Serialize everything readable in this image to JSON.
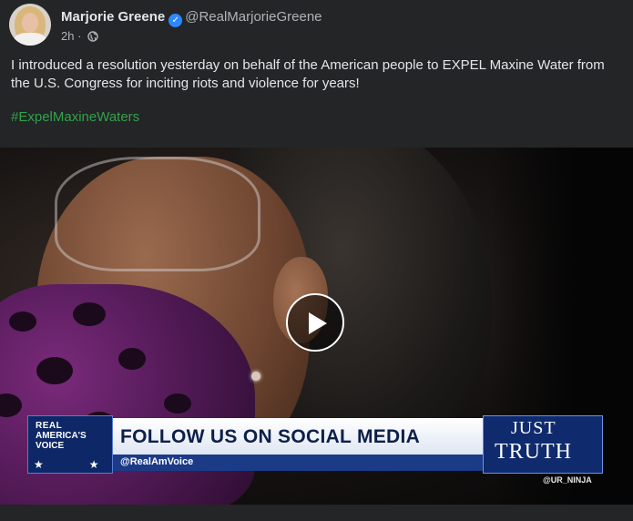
{
  "post": {
    "author_name": "Marjorie Greene",
    "author_handle": "@RealMarjorieGreene",
    "time": "2h",
    "separator": "·",
    "body": "I introduced a resolution yesterday on behalf of the American people to EXPEL Maxine Water from the U.S. Congress for inciting riots and violence for years!",
    "hashtag": "#ExpelMaxineWaters",
    "icons": {
      "verified": "verified-badge-icon",
      "audience": "globe-icon",
      "play": "play-icon"
    }
  },
  "video": {
    "network_logo": {
      "line1": "REAL",
      "line2": "AMERICA'S",
      "line3": "VOICE"
    },
    "banner_title": "FOLLOW US ON SOCIAL MEDIA",
    "banner_handle": "@RealAmVoice",
    "show_logo": {
      "line1": "JUST",
      "line2": "TRUTH"
    },
    "watermark": "@UR_NINJA"
  },
  "colors": {
    "background": "#242526",
    "hashtag": "#31a24c",
    "verified": "#2d88ff"
  }
}
